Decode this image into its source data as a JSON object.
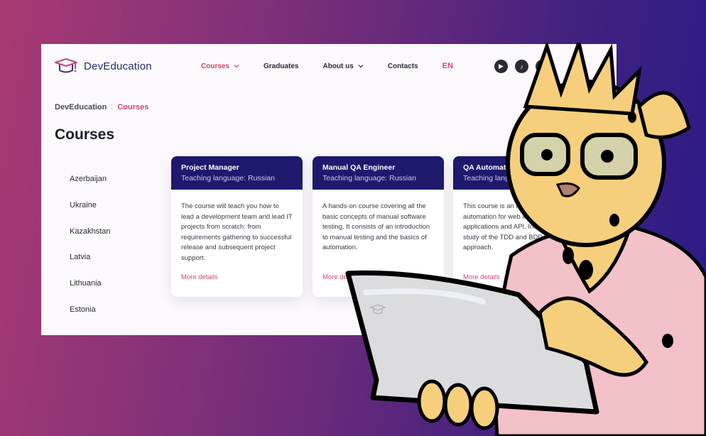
{
  "colors": {
    "accent": "#d2456a",
    "card_header": "#1d1a6e",
    "background_left": "#a83a72",
    "background_right": "#2a1a85"
  },
  "header": {
    "logo_icon": "graduation-cap-icon",
    "logo_text": "DevEducation",
    "nav": [
      {
        "label": "Courses",
        "active": true,
        "has_dropdown": true
      },
      {
        "label": "Graduates",
        "active": false,
        "has_dropdown": false
      },
      {
        "label": "About us",
        "active": false,
        "has_dropdown": true
      },
      {
        "label": "Contacts",
        "active": false,
        "has_dropdown": false
      }
    ],
    "language": "EN",
    "socials": [
      "youtube-icon",
      "tiktok-icon",
      "instagram-icon"
    ]
  },
  "breadcrumb": [
    "DevEducation",
    "Courses"
  ],
  "page_title": "Courses",
  "countries": [
    "Azerbaijan",
    "Ukraine",
    "Kazakhstan",
    "Latvia",
    "Lithuania",
    "Estonia"
  ],
  "courses": [
    {
      "title": "Project Manager",
      "subtitle": "Teaching language: Russian",
      "description": "The course will teach you how to lead a development team and lead IT projects from scratch: from requirements gathering to successful release and subsequent project support.",
      "link": "More details"
    },
    {
      "title": "Manual QA Engineer",
      "subtitle": "Teaching language: Russian",
      "description": "A hands-on course covering all the basic concepts of manual software testing. It consists of an introduction to manual testing and the basics of automation.",
      "link": "More details"
    },
    {
      "title": "QA Automation",
      "subtitle": "Teaching language: Russian",
      "description": "This course is an introduction to test automation for web and mobile applications and API. Includes a study of the TDD and BDD approach.",
      "link": "More details"
    }
  ],
  "illustration": "cheetah-mascot-with-laptop"
}
